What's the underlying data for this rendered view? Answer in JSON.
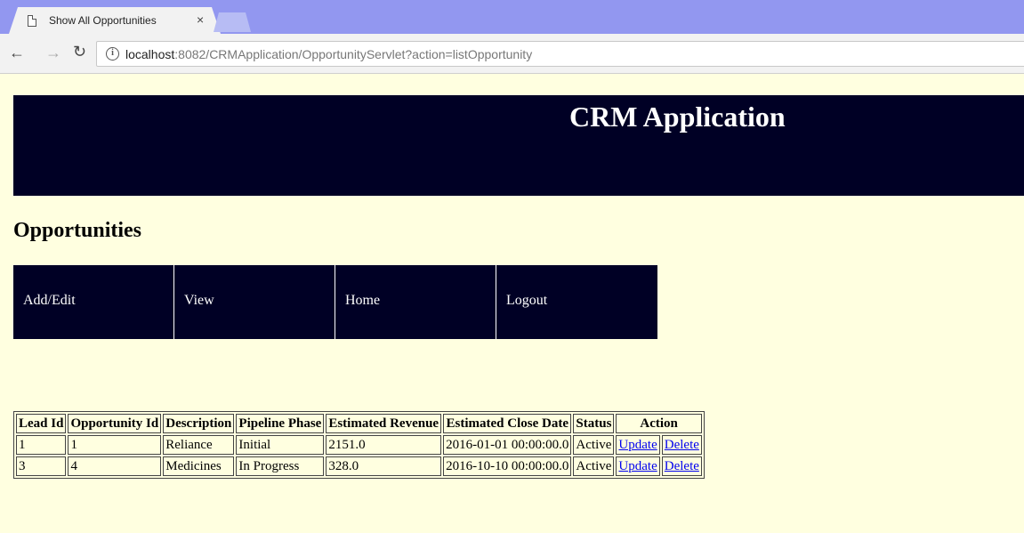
{
  "browser": {
    "tab_title": "Show All Opportunities",
    "tab_close": "×",
    "url_host": "localhost",
    "url_rest": ":8082/CRMApplication/OpportunityServlet?action=listOpportunity"
  },
  "banner": {
    "title": "CRM Application"
  },
  "page": {
    "heading": "Opportunities"
  },
  "menu": [
    "Add/Edit",
    "View",
    "Home",
    "Logout"
  ],
  "table": {
    "headers": [
      "Lead Id",
      "Opportunity Id",
      "Description",
      "Pipeline Phase",
      "Estimated Revenue",
      "Estimated Close Date",
      "Status",
      "Action"
    ],
    "rows": [
      {
        "lead_id": "1",
        "opportunity_id": "1",
        "description": "Reliance",
        "pipeline_phase": "Initial",
        "estimated_revenue": "2151.0",
        "close_date": "2016-01-01 00:00:00.0",
        "status": "Active",
        "update": "Update",
        "delete": "Delete"
      },
      {
        "lead_id": "3",
        "opportunity_id": "4",
        "description": "Medicines",
        "pipeline_phase": "In Progress",
        "estimated_revenue": "328.0",
        "close_date": "2016-10-10 00:00:00.0",
        "status": "Active",
        "update": "Update",
        "delete": "Delete"
      }
    ]
  },
  "colors": {
    "banner_bg": "#000025",
    "page_bg": "#ffffe0",
    "tabstrip": "#9297f0",
    "link": "#0000ee"
  },
  "icons": [
    "document-icon",
    "back-arrow-icon",
    "forward-arrow-icon",
    "reload-icon",
    "info-icon"
  ]
}
